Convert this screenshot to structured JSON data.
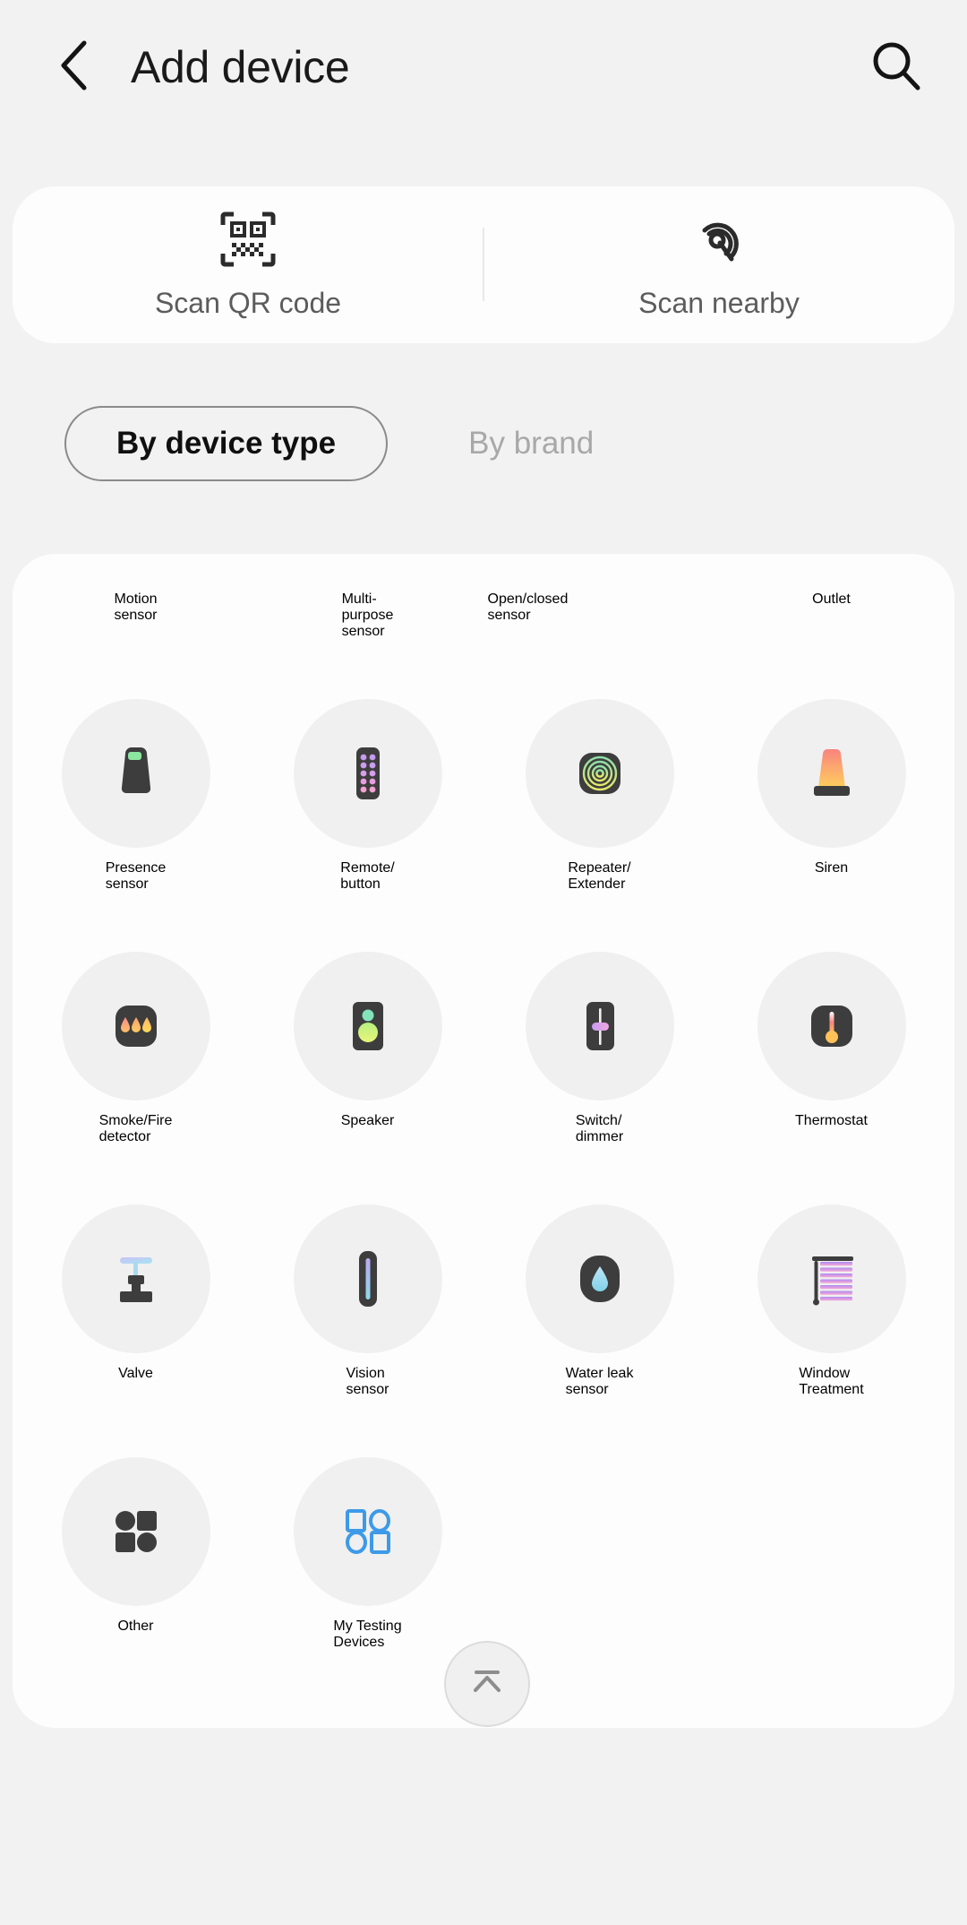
{
  "header": {
    "back_icon": "chevron-left-icon",
    "title": "Add device",
    "search_icon": "search-icon"
  },
  "scan": {
    "qr": {
      "icon": "qr-code-icon",
      "label": "Scan QR code"
    },
    "nearby": {
      "icon": "scan-nearby-icon",
      "label": "Scan nearby"
    }
  },
  "tabs": {
    "by_device_type": "By device type",
    "by_brand": "By brand",
    "selected": "By device type"
  },
  "grid": {
    "row0_labels": [
      "Motion\nsensor",
      "Multi-\npurpose\nsensor",
      "Open/closed\nsensor",
      "Outlet"
    ],
    "items": [
      {
        "label": "Presence sensor",
        "icon": "presence-sensor-icon"
      },
      {
        "label": "Remote/ button",
        "icon": "remote-button-icon"
      },
      {
        "label": "Repeater/ Extender",
        "icon": "repeater-extender-icon"
      },
      {
        "label": "Siren",
        "icon": "siren-icon"
      },
      {
        "label": "Smoke/Fire detector",
        "icon": "smoke-fire-detector-icon"
      },
      {
        "label": "Speaker",
        "icon": "speaker-icon"
      },
      {
        "label": "Switch/ dimmer",
        "icon": "switch-dimmer-icon"
      },
      {
        "label": "Thermostat",
        "icon": "thermostat-icon"
      },
      {
        "label": "Valve",
        "icon": "valve-icon"
      },
      {
        "label": "Vision sensor",
        "icon": "vision-sensor-icon"
      },
      {
        "label": "Water leak sensor",
        "icon": "water-leak-sensor-icon"
      },
      {
        "label": "Window Treatment",
        "icon": "window-treatment-icon"
      },
      {
        "label": "Other",
        "icon": "other-icon"
      },
      {
        "label": "My Testing Devices",
        "icon": "my-testing-devices-icon"
      }
    ],
    "labels": {
      "presence_sensor_l1": "Presence",
      "presence_sensor_l2": "sensor",
      "remote_button_l1": "Remote/",
      "remote_button_l2": "button",
      "repeater_l1": "Repeater/",
      "repeater_l2": "Extender",
      "siren": "Siren",
      "smoke_l1": "Smoke/Fire",
      "smoke_l2": "detector",
      "speaker": "Speaker",
      "switch_l1": "Switch/",
      "switch_l2": "dimmer",
      "thermostat": "Thermostat",
      "valve": "Valve",
      "vision_l1": "Vision",
      "vision_l2": "sensor",
      "waterleak_l1": "Water leak",
      "waterleak_l2": "sensor",
      "window_l1": "Window",
      "window_l2": "Treatment",
      "other": "Other",
      "testing_l1": "My Testing",
      "testing_l2": "Devices",
      "motion_l1": "Motion",
      "motion_l2": "sensor",
      "multi_l1": "Multi-",
      "multi_l2": "purpose",
      "multi_l3": "sensor",
      "openclosed_l1": "Open/closed",
      "openclosed_l2": "sensor",
      "outlet": "Outlet"
    }
  },
  "fab": {
    "icon": "scroll-to-top-icon"
  },
  "colors": {
    "page_bg": "#f2f2f2",
    "card_bg": "#fdfdfd",
    "icon_circle_bg": "#f0f0f0",
    "device_body": "#3d3d3d",
    "text_primary": "#1c1c1c",
    "text_secondary": "#5c5c5c",
    "text_muted": "#a8a8a8",
    "accent_blue": "#3d9ae8"
  }
}
